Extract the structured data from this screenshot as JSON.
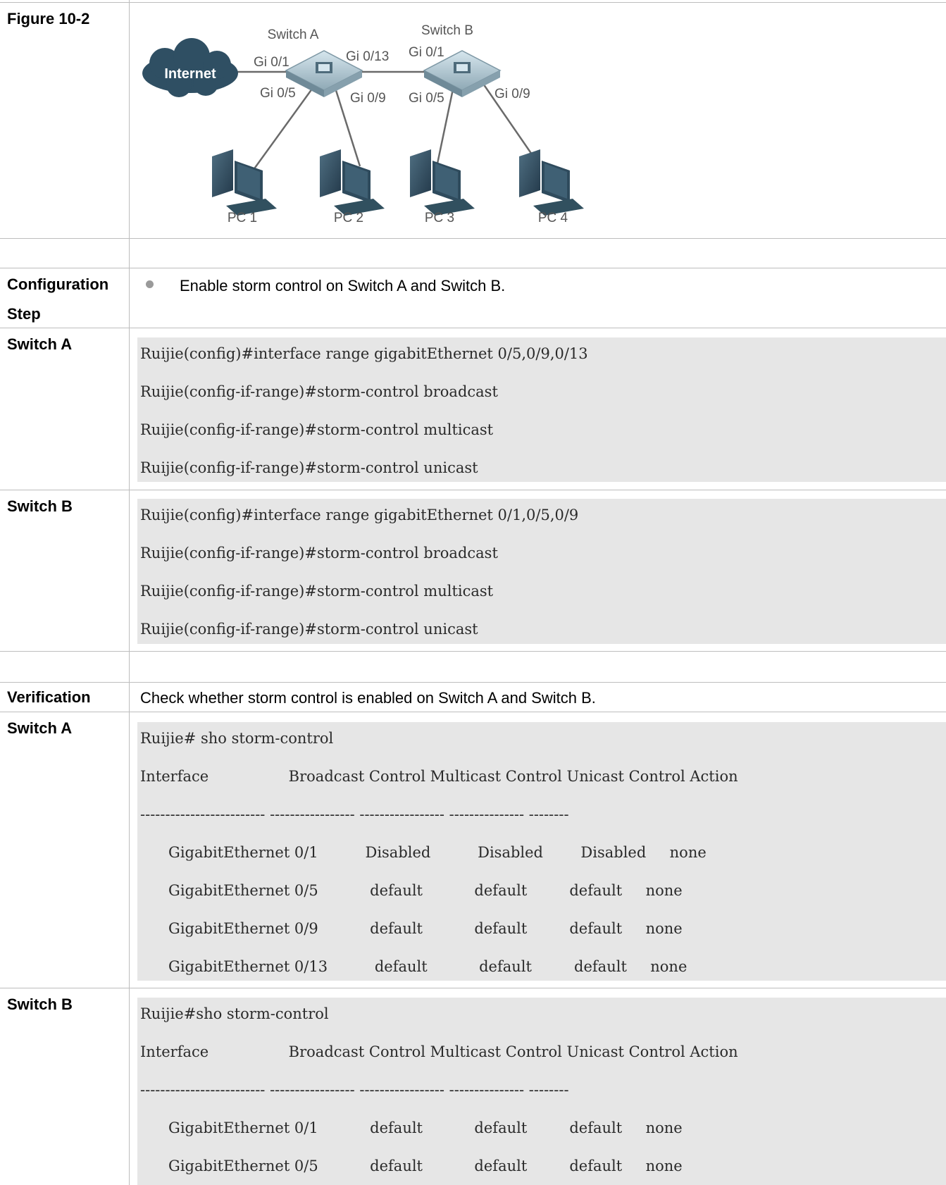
{
  "figure": {
    "label": "Figure 10-2",
    "cloud_label": "Internet",
    "switch_a": "Switch A",
    "switch_b": "Switch B",
    "ports": {
      "a_gi01": "Gi 0/1",
      "a_gi013": "Gi 0/13",
      "a_gi05": "Gi 0/5",
      "a_gi09": "Gi 0/9",
      "b_gi01": "Gi 0/1",
      "b_gi05": "Gi 0/5",
      "b_gi09": "Gi 0/9"
    },
    "pcs": [
      "PC 1",
      "PC 2",
      "PC 3",
      "PC 4"
    ]
  },
  "config": {
    "label": "Configuration Step",
    "label_line1": "Configuration",
    "label_line2": "Step",
    "bullet_text": "Enable storm control on Switch A and Switch B.",
    "switch_a": {
      "label": "Switch A",
      "lines": [
        "Ruijie(config)#interface range gigabitEthernet 0/5,0/9,0/13",
        "Ruijie(config-if-range)#storm-control broadcast",
        "Ruijie(config-if-range)#storm-control multicast",
        "Ruijie(config-if-range)#storm-control unicast"
      ]
    },
    "switch_b": {
      "label": "Switch B",
      "lines": [
        "Ruijie(config)#interface range gigabitEthernet 0/1,0/5,0/9",
        "Ruijie(config-if-range)#storm-control broadcast",
        "Ruijie(config-if-range)#storm-control multicast",
        "Ruijie(config-if-range)#storm-control unicast"
      ]
    }
  },
  "verification": {
    "label": "Verification",
    "text": "Check whether storm control is enabled on Switch A and Switch B.",
    "switch_a": {
      "label": "Switch A",
      "lines": [
        "Ruijie# sho storm-control",
        "Interface                 Broadcast Control Multicast Control Unicast Control Action",
        "------------------------- ----------------- ----------------- --------------- --------",
        "      GigabitEthernet 0/1          Disabled          Disabled        Disabled     none",
        "      GigabitEthernet 0/5           default           default         default     none",
        "      GigabitEthernet 0/9           default           default         default     none",
        "      GigabitEthernet 0/13          default           default         default     none"
      ]
    },
    "switch_b": {
      "label": "Switch B",
      "lines": [
        "Ruijie#sho storm-control",
        "Interface                 Broadcast Control Multicast Control Unicast Control Action",
        "------------------------- ----------------- ----------------- --------------- --------",
        "      GigabitEthernet 0/1           default           default         default     none",
        "      GigabitEthernet 0/5           default           default         default     none"
      ]
    }
  }
}
